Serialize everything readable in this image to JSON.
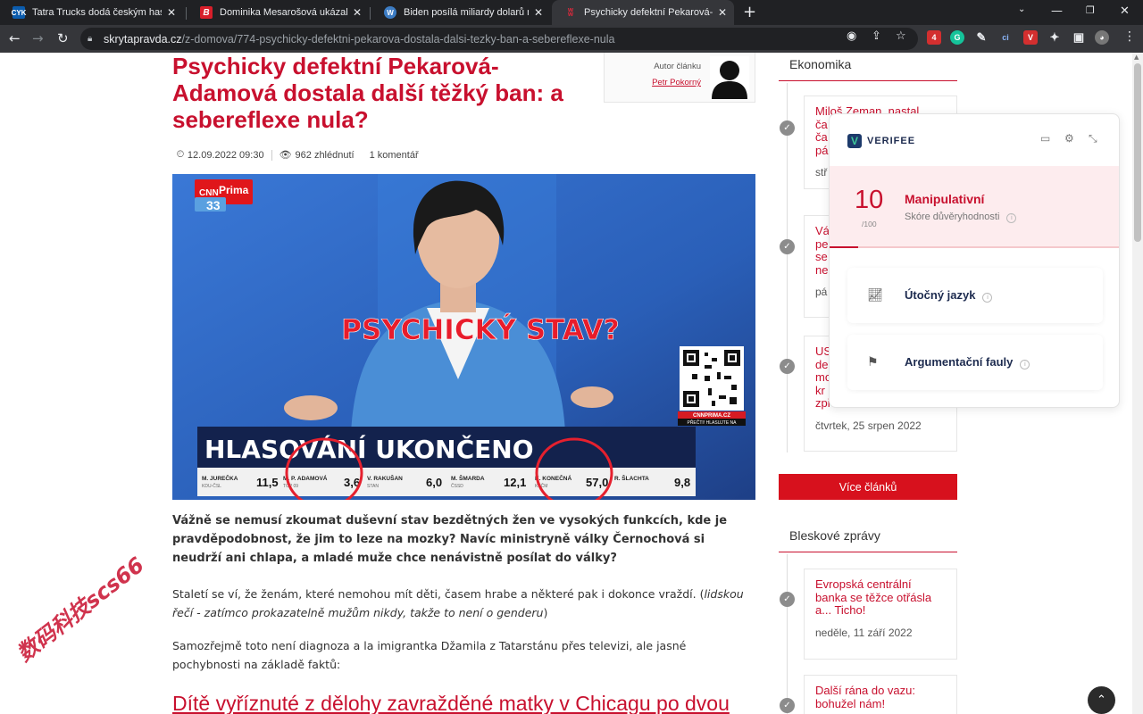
{
  "browser": {
    "tabs": [
      {
        "title": "Tatra Trucks dodá českým hasičům",
        "favicon": "cyk-favicon",
        "favicon_color": "#0b5cad",
        "favicon_text": "CYK"
      },
      {
        "title": "Dominika Mesarošová ukázala dv",
        "favicon": "b-favicon",
        "favicon_color": "#d81e2a",
        "favicon_text": "B"
      },
      {
        "title": "Biden posílá miliardy dolarů na U",
        "favicon": "wordpress-favicon",
        "favicon_color": "#3c7cc4",
        "favicon_text": "W"
      },
      {
        "title": "Psychicky defektní Pekarová-Ada",
        "favicon": "sp-favicon",
        "favicon_color": "#8a1d2b",
        "favicon_text": "SP",
        "active": true
      }
    ],
    "url_host": "skrytapravda.cz",
    "url_path": "/z-domova/774-psychicky-defektni-pekarova-dostala-dalsi-tezky-ban-a-sebereflexe-nula"
  },
  "article": {
    "title": "Psychicky defektní Pekarová-Adamová dostala další těžký ban: a sebereflexe nula?",
    "author_label": "Autor článku",
    "author_name": "Petr Pokorný",
    "date": "12.09.2022 09:30",
    "views": "962 zhlédnutí",
    "comments": "1 komentář",
    "image": {
      "channel_logo": "CNN Prima NEWS",
      "channel_number": "33",
      "overlay_text": "PSYCHICKÝ STAV?",
      "banner": "HLASOVÁNÍ UKONČENO",
      "qr_caption_1": "CNNPRIMA.CZ",
      "qr_caption_2": "PŘEČTI! HLASUJTE NA",
      "results": [
        {
          "name": "M. JUREČKA",
          "party": "KDU-ČSL",
          "value": "11,5"
        },
        {
          "name": "M. P. ADAMOVÁ",
          "party": "TOP 09",
          "value": "3,6"
        },
        {
          "name": "V. RAKUŠAN",
          "party": "STAN",
          "value": "6,0"
        },
        {
          "name": "M. ŠMARDA",
          "party": "ČSSD",
          "value": "12,1"
        },
        {
          "name": "K. KONEČNÁ",
          "party": "KSČM",
          "value": "57,0"
        },
        {
          "name": "R. ŠLACHTA",
          "party": "",
          "value": "9,8"
        }
      ]
    },
    "lead": "Vážně se nemusí zkoumat duševní stav bezdětných žen ve vysokých funkcích, kde je pravděpodobnost, že jim to leze na mozky? Navíc ministryně války Černochová si neudrží ani chlapa, a mladé muže chce nenávistně posílat do války?",
    "para1_text": "Staletí se ví, že ženám, které nemohou mít děti, časem hrabe a některé pak i dokonce vraždí. (",
    "para1_italic": "lidskou řečí - zatímco prokazatelně mužům nikdy, takže to není o genderu",
    "para1_end": ")",
    "para2": "Samozřejmě toto není diagnoza a la imigrantka Džamila z Tatarstánu přes televizi, ale jasné pochybnosti na základě faktů:",
    "link_heading": "Dítě vyříznuté z dělohy zavražděné matky v Chicagu po dvou"
  },
  "sidebar": {
    "section1_title": "Ekonomika",
    "cards1": [
      {
        "title": "Miloš Zeman...",
        "date": "stř"
      },
      {
        "title": "Vá pe se ne",
        "date": "pá"
      },
      {
        "title": "US de mo kr zpi",
        "date": "čtvrtek, 25 srpen 2022"
      }
    ],
    "card1_text": "Miloš Zeman, nastal",
    "card1_lines": [
      "ča",
      "ča",
      "pá"
    ],
    "card2_lines": [
      "Vá",
      "pe",
      "se",
      "ne"
    ],
    "card3_lines": [
      "US",
      "de",
      "mo",
      "kr",
      "zpi"
    ],
    "more_button": "Více článků",
    "section2_title": "Bleskové zprávy",
    "cards2": [
      {
        "title": "Evropská centrální banka se těžce otřásla a... Ticho!",
        "date": "neděle, 11 září 2022"
      },
      {
        "title": "Další rána do vazu: bohužel nám!",
        "date": ""
      }
    ]
  },
  "verifee": {
    "brand": "VERIFEE",
    "score": "10",
    "score_max": "/100",
    "score_fraction": 0.1,
    "verdict": "Manipulativní",
    "score_label": "Skóre důvěryhodnosti",
    "row1": "Útočný jazyk",
    "row2": "Argumentační fauly"
  },
  "watermark": "数码科技scs66",
  "colors": {
    "accent": "#c8102e",
    "button": "#d7111d",
    "verifee_bg": "#fdecee"
  }
}
